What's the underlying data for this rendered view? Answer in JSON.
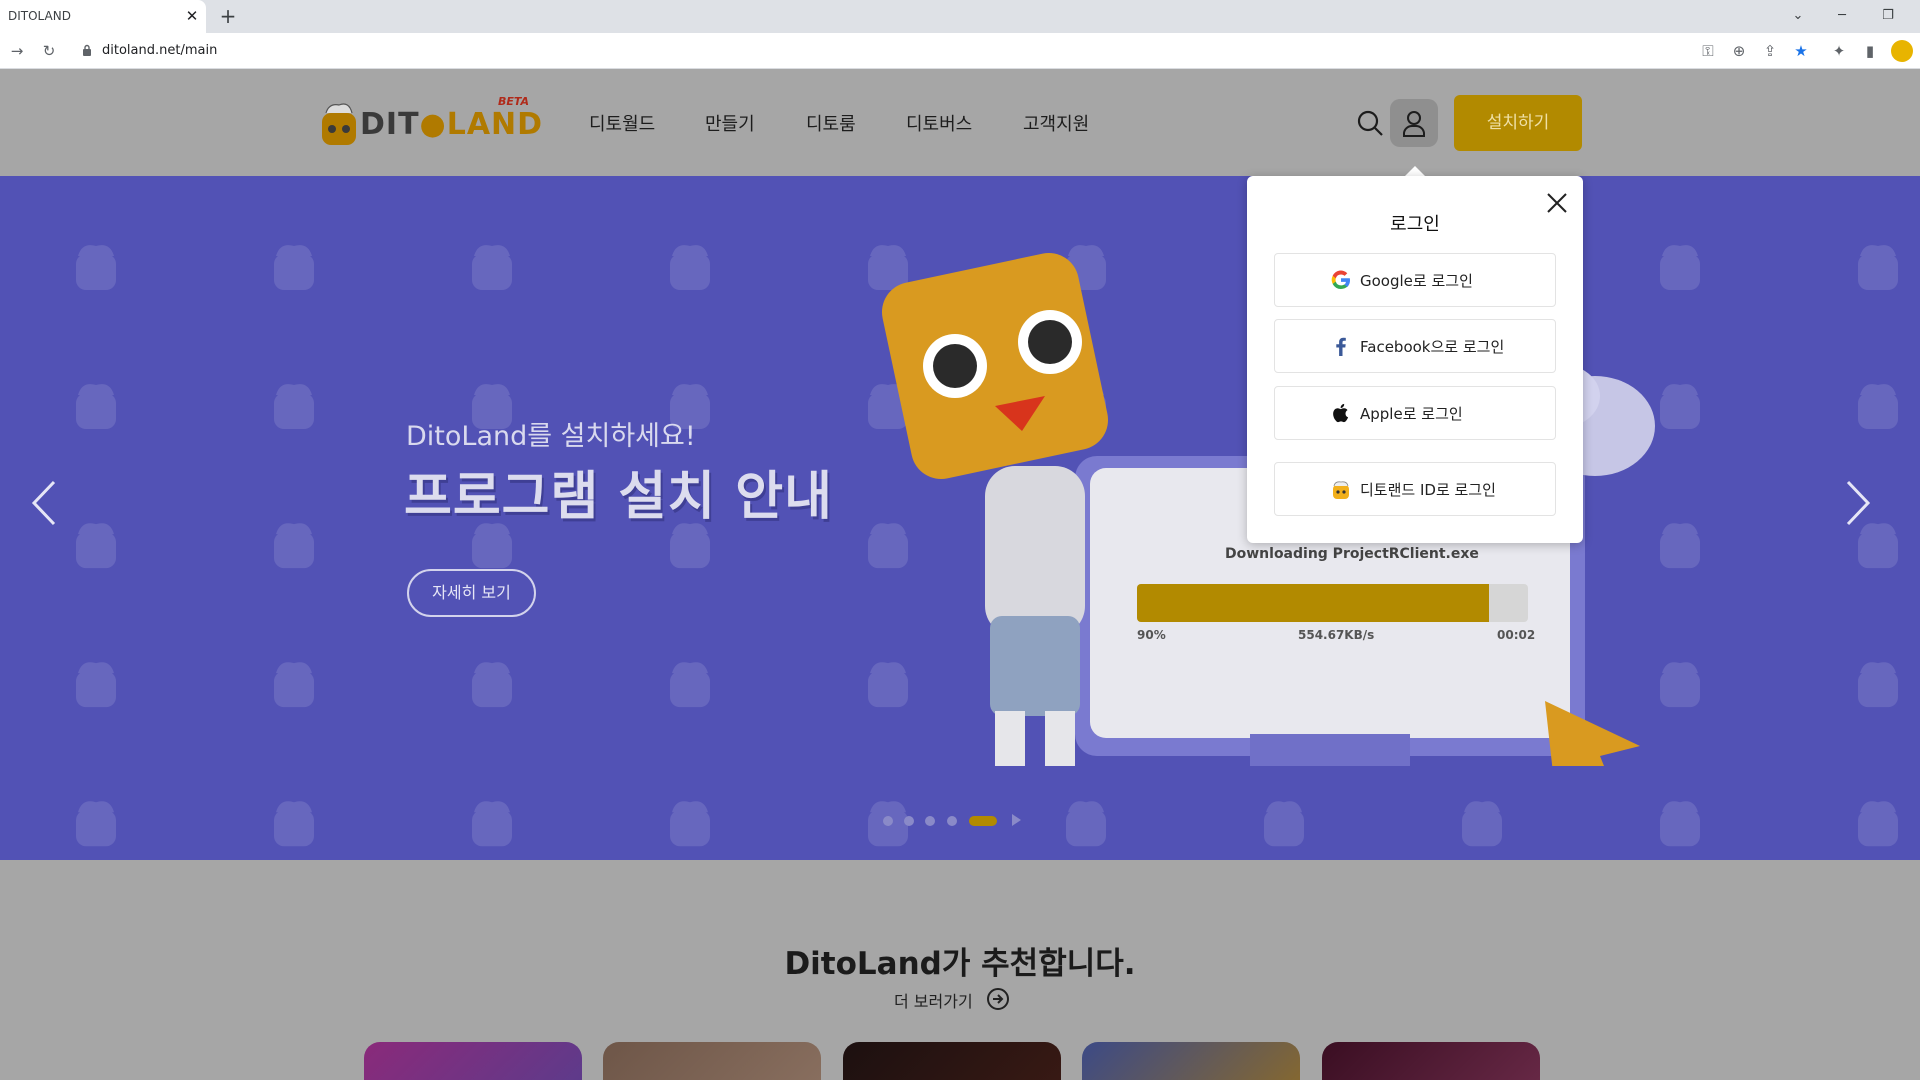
{
  "browser": {
    "tab_title": "DITOLAND",
    "tab_close": "✕",
    "new_tab": "+",
    "url": "ditoland.net/main"
  },
  "header": {
    "logo_text_a": "DIT",
    "logo_text_b": "LAND",
    "logo_beta": "BETA",
    "nav": [
      "디토월드",
      "만들기",
      "디토룸",
      "디토버스",
      "고객지원"
    ],
    "install_label": "설치하기"
  },
  "hero": {
    "subtitle": "DitoLand를 설치하세요!",
    "title": "프로그램 설치 안내",
    "more_label": "자세히 보기",
    "download_label": "Downloading ProjectRClient.exe",
    "download_percent": "90%",
    "download_progress": 0.9,
    "download_speed": "554.67KB/s",
    "download_time": "00:02",
    "slides_total": 5,
    "active_slide": 5
  },
  "login_popup": {
    "title": "로그인",
    "buttons": [
      {
        "label": "Google로 로그인",
        "icon": "google-icon"
      },
      {
        "label": "Facebook으로 로그인",
        "icon": "facebook-icon"
      },
      {
        "label": "Apple로 로그인",
        "icon": "apple-icon"
      },
      {
        "label": "디토랜드 ID로 로그인",
        "icon": "ditoland-icon"
      }
    ]
  },
  "recommend": {
    "title": "DitoLand가 추천합니다.",
    "more_label": "더 보러가기"
  },
  "colors": {
    "brand_gold": "#b28a00",
    "hero_bg": "#5252b5",
    "overlay_gray": "#a6a6a6"
  }
}
